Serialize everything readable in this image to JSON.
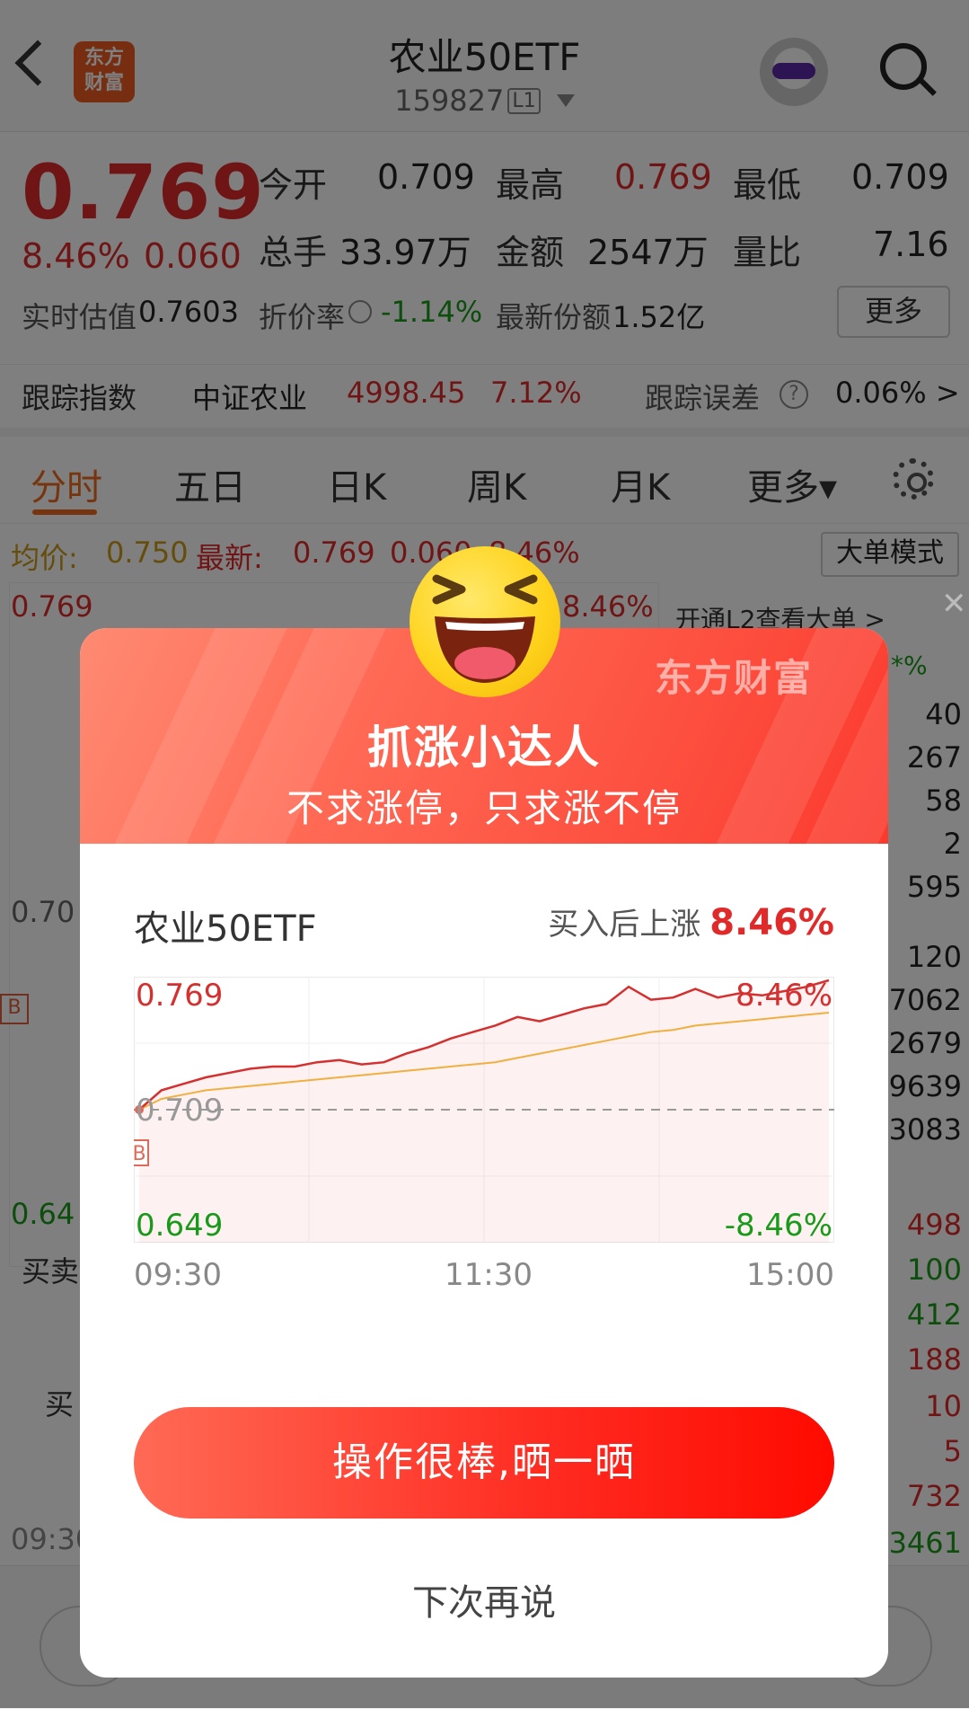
{
  "header": {
    "back_label": "",
    "logo_text": "东方财富",
    "title": "农业50ETF",
    "code": "159827",
    "level_badge": "L1"
  },
  "quote": {
    "price": "0.769",
    "change_pct": "8.46%",
    "change_abs": "0.060",
    "open_label": "今开",
    "open_value": "0.709",
    "high_label": "最高",
    "high_value": "0.769",
    "low_label": "最低",
    "low_value": "0.709",
    "volume_label": "总手",
    "volume_value": "33.97万",
    "amount_label": "金额",
    "amount_value": "2547万",
    "ratio_label": "量比",
    "ratio_value": "7.16",
    "iopv_label": "实时估值",
    "iopv_value": "0.7603",
    "discount_label": "折价率",
    "discount_value": "-1.14%",
    "shares_label": "最新份额",
    "shares_value": "1.52亿",
    "more_label": "更多"
  },
  "tracking": {
    "index_label": "跟踪指数",
    "index_name": "中证农业",
    "index_value": "4998.45",
    "index_change": "7.12%",
    "error_label": "跟踪误差",
    "error_value": "0.06% >"
  },
  "tabs": [
    {
      "label": "分时"
    },
    {
      "label": "五日"
    },
    {
      "label": "日K"
    },
    {
      "label": "周K"
    },
    {
      "label": "月K"
    },
    {
      "label": "更多▾"
    }
  ],
  "avgline": {
    "avg_label": "均价:",
    "avg_value": "0.750",
    "latest_label": "最新:",
    "latest_value": "0.769",
    "latest_change": "0.060",
    "latest_pct": "8.46%",
    "big_order_mode": "大单模式"
  },
  "bg_chart": {
    "top_left": "0.769",
    "top_right": "8.46%",
    "mid_left": "0.70",
    "bottom_left": "0.64",
    "buy_sell": "买卖",
    "buy": "买",
    "time_start": "09:30",
    "marker": "B",
    "l2_prompt": "开通L2查看大单 >",
    "l2_pct": "*%"
  },
  "right_column": {
    "values": [
      "40",
      "267",
      "58",
      "2",
      "595",
      "120",
      "7062",
      "2679",
      "9639",
      "3083"
    ],
    "trades": [
      "498",
      "100",
      "412",
      "188",
      "10",
      "5",
      "732",
      "3461"
    ]
  },
  "modal": {
    "brand": "东方财富",
    "title": "抓涨小达人",
    "subtitle": "不求涨停，只求涨不停",
    "stock_name": "农业50ETF",
    "rise_label": "买入后上涨",
    "rise_value": "8.46%",
    "share_button": "操作很棒,晒一晒",
    "later_button": "下次再说"
  },
  "chart_data": {
    "type": "line",
    "title": "",
    "y_top_label": "0.769",
    "y_mid_label": "0.709",
    "y_bottom_label": "0.649",
    "pct_top_label": "8.46%",
    "pct_bottom_label": "-8.46%",
    "x_tick_labels": [
      "09:30",
      "11:30",
      "15:00"
    ],
    "ylim": [
      0.649,
      0.769
    ],
    "baseline": 0.709,
    "marker_label": "B",
    "series": [
      {
        "values": [
          0.709,
          0.718,
          0.721,
          0.724,
          0.726,
          0.728,
          0.729,
          0.729,
          0.731,
          0.732,
          0.73,
          0.731,
          0.735,
          0.738,
          0.742,
          0.745,
          0.748,
          0.752,
          0.75,
          0.753,
          0.756,
          0.758,
          0.766,
          0.76,
          0.761,
          0.765,
          0.761,
          0.763,
          0.762,
          0.764,
          0.766,
          0.769
        ],
        "color": "#d43030"
      },
      {
        "values": [
          0.709,
          0.714,
          0.716,
          0.718,
          0.719,
          0.72,
          0.721,
          0.722,
          0.723,
          0.724,
          0.725,
          0.726,
          0.727,
          0.728,
          0.729,
          0.73,
          0.731,
          0.733,
          0.735,
          0.737,
          0.739,
          0.741,
          0.743,
          0.745,
          0.746,
          0.748,
          0.749,
          0.75,
          0.751,
          0.752,
          0.753,
          0.754
        ],
        "color": "#f0b040"
      }
    ]
  }
}
